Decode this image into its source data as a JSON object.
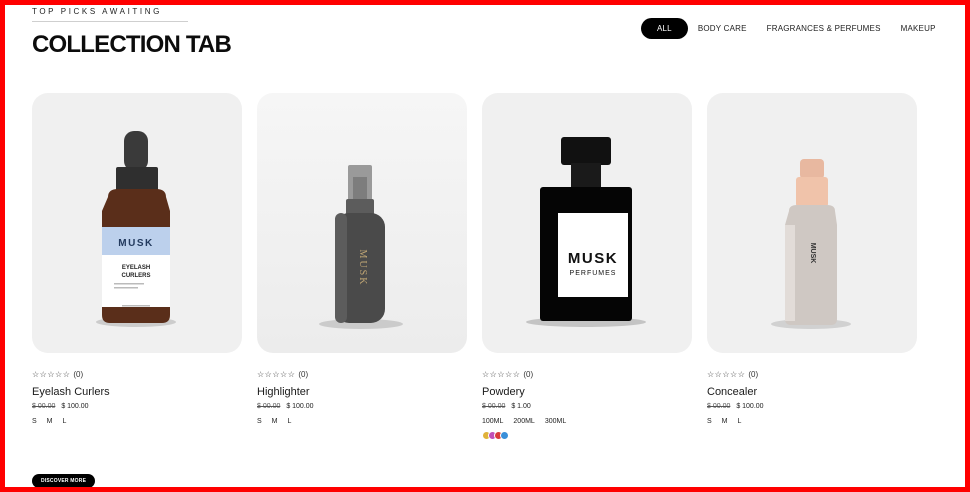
{
  "header": {
    "eyebrow": "TOP PICKS AWAITING",
    "title": "COLLECTION TAB"
  },
  "tabs": [
    {
      "label": "ALL",
      "active": true
    },
    {
      "label": "BODY CARE",
      "active": false
    },
    {
      "label": "FRAGRANCES & PERFUMES",
      "active": false
    },
    {
      "label": "MAKEUP",
      "active": false
    }
  ],
  "products": [
    {
      "name": "Eyelash Curlers",
      "stars": "☆☆☆☆☆",
      "reviews": "(0)",
      "old_price": "$ 00.00",
      "price": "$ 100.00",
      "options": [
        "S",
        "M",
        "L"
      ],
      "image": {
        "type": "dropper-bottle",
        "brand": "MUSK",
        "label": "EYELASH CURLERS"
      }
    },
    {
      "name": "Highlighter",
      "stars": "☆☆☆☆☆",
      "reviews": "(0)",
      "old_price": "$ 00.00",
      "price": "$ 100.00",
      "options": [
        "S",
        "M",
        "L"
      ],
      "image": {
        "type": "spray-bottle",
        "brand": "MUSK"
      }
    },
    {
      "name": "Powdery",
      "stars": "☆☆☆☆☆",
      "reviews": "(0)",
      "old_price": "$ 00.00",
      "price": "$ 1.00",
      "options": [
        "100ML",
        "200ML",
        "300ML"
      ],
      "swatches": [
        "#e0b23a",
        "#c14fb8",
        "#d93b3b",
        "#3a8fd9"
      ],
      "image": {
        "type": "perfume-bottle",
        "brand": "MUSK",
        "label": "PERFUMES"
      }
    },
    {
      "name": "Concealer",
      "stars": "☆☆☆☆☆",
      "reviews": "(0)",
      "old_price": "$ 00.00",
      "price": "$ 100.00",
      "options": [
        "S",
        "M",
        "L"
      ],
      "image": {
        "type": "pump-bottle",
        "brand": "MUSK"
      }
    }
  ],
  "cta": {
    "label": "DISCOVER MORE"
  },
  "colors": {
    "accent": "#000000",
    "frame": "#ff0000",
    "card_bg": "#f0f0f0"
  }
}
